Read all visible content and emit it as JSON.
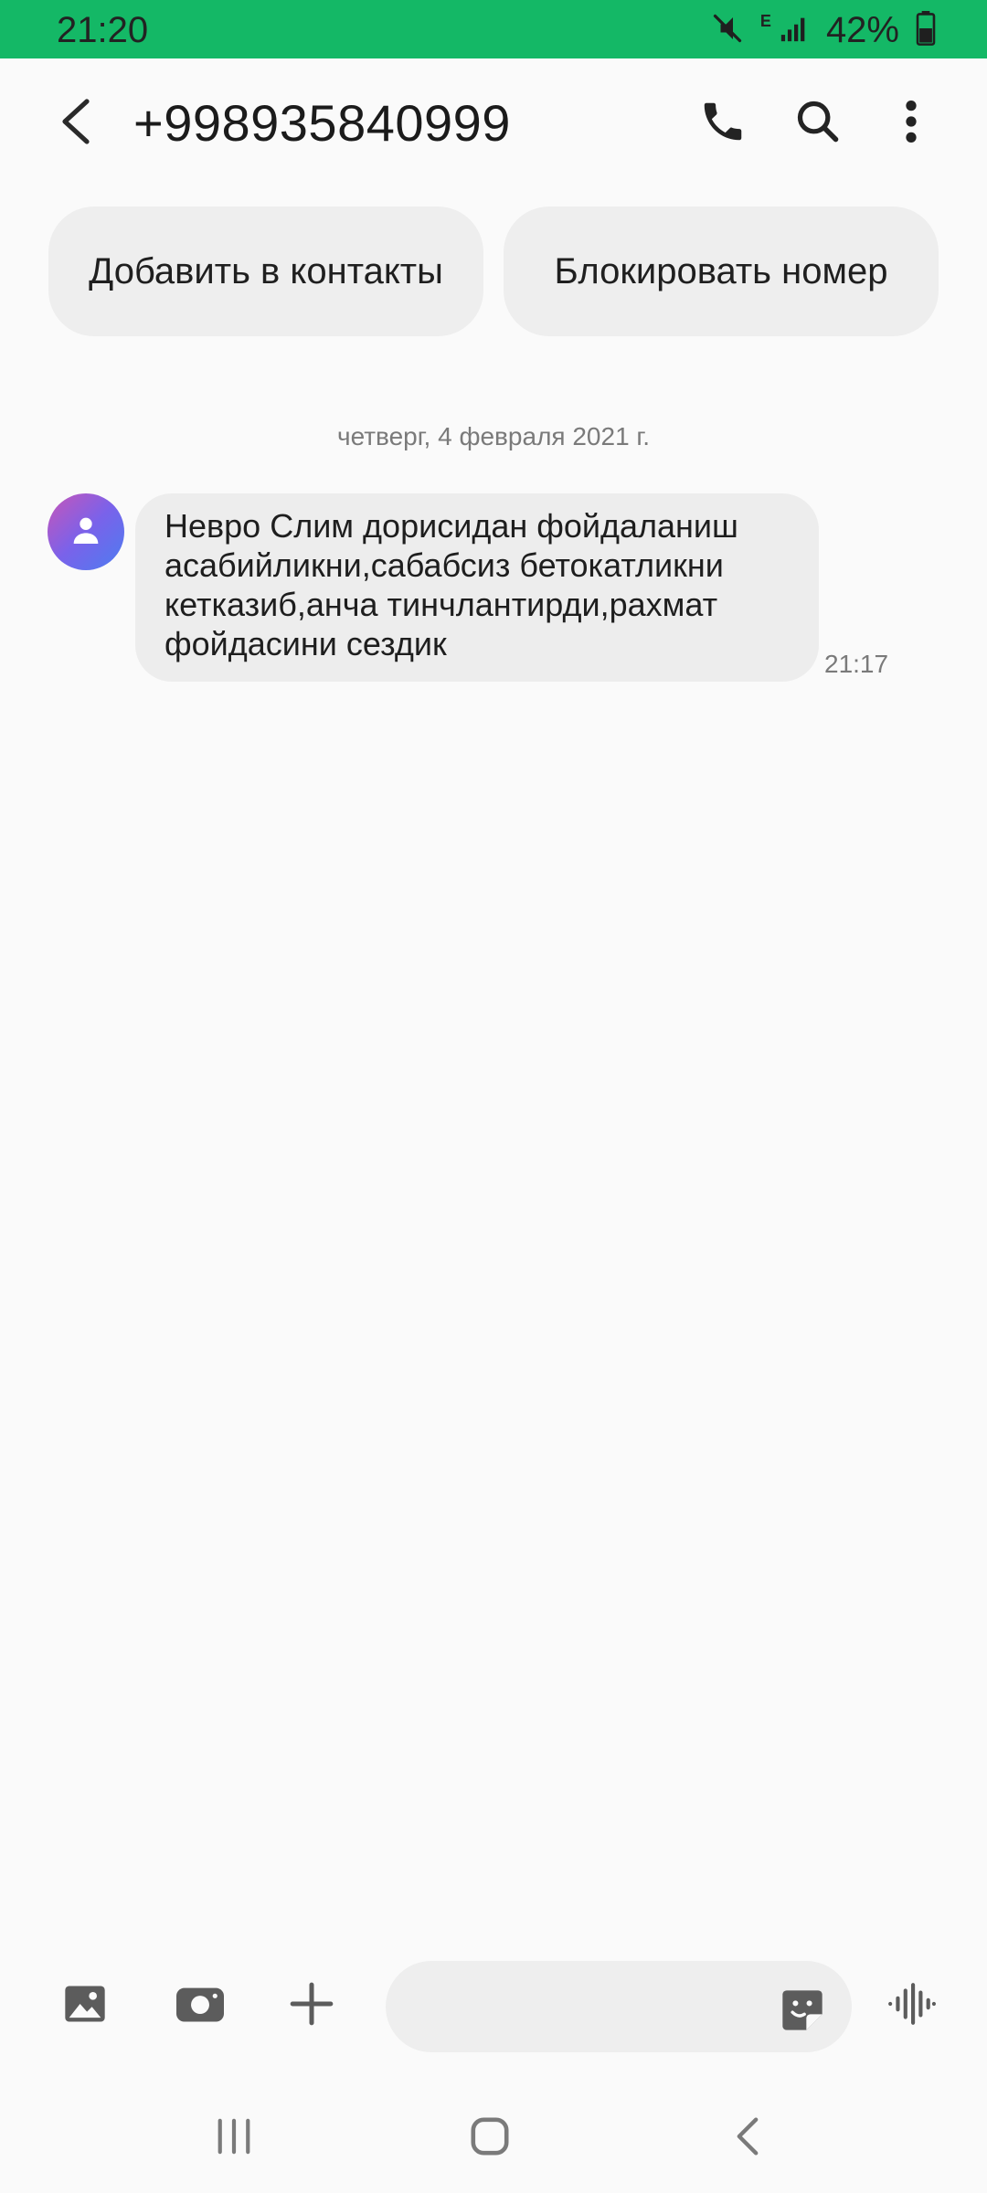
{
  "status_bar": {
    "time": "21:20",
    "network_type": "E",
    "battery_percent": "42%",
    "icons": [
      "mute-icon",
      "signal-icon",
      "battery-icon"
    ]
  },
  "header": {
    "title": "+998935840999",
    "icons": [
      "back-arrow-icon",
      "phone-icon",
      "search-icon",
      "more-vertical-icon"
    ]
  },
  "actions": {
    "add_to_contacts": "Добавить в контакты",
    "block_number": "Блокировать номер"
  },
  "conversation": {
    "date_divider": "четверг, 4 февраля 2021 г.",
    "messages": [
      {
        "direction": "incoming",
        "lines": [
          "Невро Слим дорисидан фойдаланиш",
          "асабийликни,сабабсиз бетокатликни",
          "кетказиб,анча тинчлантирди,рахмат",
          "фойдасини сездик"
        ],
        "time": "21:17"
      }
    ]
  },
  "composer": {
    "placeholder": "",
    "icons": [
      "gallery-icon",
      "camera-icon",
      "plus-icon",
      "sticker-icon",
      "voice-icon"
    ]
  },
  "navigation": {
    "icons": [
      "recents-icon",
      "home-icon",
      "back-icon"
    ]
  },
  "colors": {
    "status_bar": "#14b866",
    "background": "#fafafa",
    "bubble": "#ededed",
    "pill": "#eeeeee",
    "icon": "#2a2a2a",
    "avatar_gradient": [
      "#c855b8",
      "#7a62ea",
      "#4c7df0"
    ]
  }
}
